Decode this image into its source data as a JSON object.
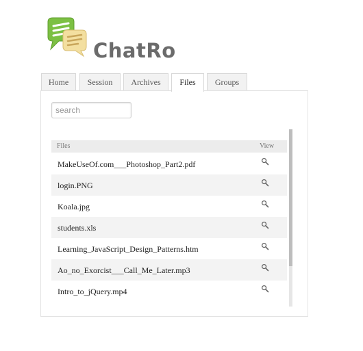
{
  "app": {
    "name": "ChatRo"
  },
  "tabs": [
    {
      "label": "Home",
      "active": false
    },
    {
      "label": "Session",
      "active": false
    },
    {
      "label": "Archives",
      "active": false
    },
    {
      "label": "Files",
      "active": true
    },
    {
      "label": "Groups",
      "active": false
    }
  ],
  "search": {
    "placeholder": "search",
    "value": ""
  },
  "files_table": {
    "columns": [
      "Files",
      "View"
    ],
    "rows": [
      {
        "name": "MakeUseOf.com___Photoshop_Part2.pdf",
        "view_icon": "magnifier-icon"
      },
      {
        "name": "login.PNG",
        "view_icon": "magnifier-icon"
      },
      {
        "name": "Koala.jpg",
        "view_icon": "magnifier-icon"
      },
      {
        "name": "students.xls",
        "view_icon": "magnifier-icon"
      },
      {
        "name": "Learning_JavaScript_Design_Patterns.htm",
        "view_icon": "magnifier-icon"
      },
      {
        "name": "Ao_no_Exorcist___Call_Me_Later.mp3",
        "view_icon": "magnifier-icon"
      },
      {
        "name": "Intro_to_jQuery.mp4",
        "view_icon": "magnifier-icon"
      }
    ]
  },
  "colors": {
    "logo_green": "#7cc043",
    "logo_cream": "#f3dfa0",
    "brand_text": "#6b6b6b"
  }
}
